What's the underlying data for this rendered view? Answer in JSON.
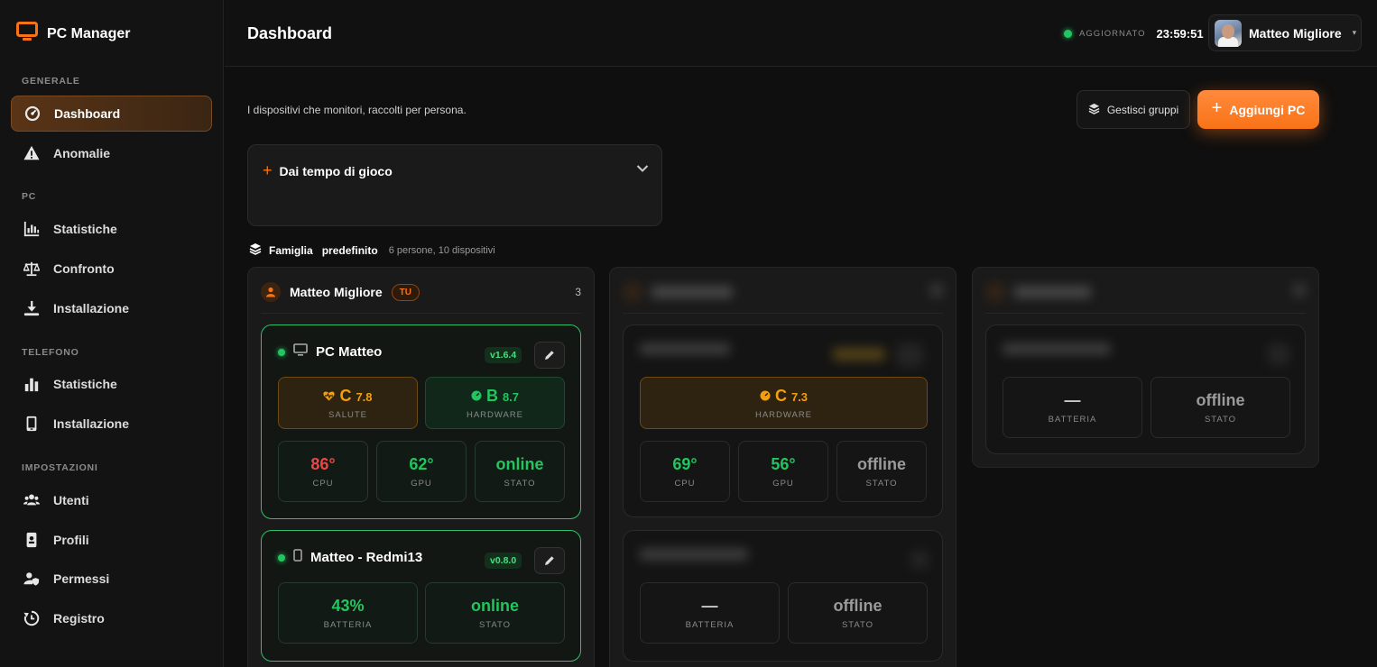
{
  "app": {
    "title": "PC Manager"
  },
  "sidebar": {
    "sections": [
      {
        "label": "GENERALE"
      },
      {
        "label": "PC"
      },
      {
        "label": "TELEFONO"
      },
      {
        "label": "IMPOSTAZIONI"
      }
    ],
    "items": [
      {
        "label": "Dashboard",
        "icon": "dashboard-gauge-icon",
        "active": true
      },
      {
        "label": "Anomalie",
        "icon": "warning-triangle-icon"
      },
      {
        "label": "Statistiche",
        "icon": "bar-chart-icon"
      },
      {
        "label": "Confronto",
        "icon": "scale-icon"
      },
      {
        "label": "Installazione",
        "icon": "download-icon"
      },
      {
        "label": "Statistiche",
        "icon": "bar-chart-icon"
      },
      {
        "label": "Installazione",
        "icon": "phone-icon"
      },
      {
        "label": "Utenti",
        "icon": "users-icon"
      },
      {
        "label": "Profili",
        "icon": "id-card-icon"
      },
      {
        "label": "Permessi",
        "icon": "user-shield-icon"
      },
      {
        "label": "Registro",
        "icon": "history-icon"
      }
    ]
  },
  "header": {
    "title": "Dashboard",
    "status_label": "AGGIORNATO",
    "status_time": "23:59:51",
    "user_name": "Matteo Migliore"
  },
  "toolbar": {
    "subtitle": "I dispositivi che monitori, raccolti per persona.",
    "manage_groups_label": "Gestisci gruppi",
    "add_pc_label": "Aggiungi PC"
  },
  "collapsible": {
    "title": "Dai tempo di gioco"
  },
  "group": {
    "name": "Famiglia",
    "tag": "predefinito",
    "meta": "6 persone, 10 dispositivi"
  },
  "people": [
    {
      "name": "Matteo Migliore",
      "badge": "TU",
      "count": "3",
      "devices": [
        {
          "name": "PC Matteo",
          "version": "v1.6.4",
          "scores": [
            {
              "grade": "C",
              "value": "7.8",
              "label": "SALUTE",
              "icon": "heartbeat-icon"
            },
            {
              "grade": "B",
              "value": "8.7",
              "label": "HARDWARE",
              "icon": "gauge-icon"
            }
          ],
          "metrics": [
            {
              "value": "86°",
              "label": "CPU"
            },
            {
              "value": "62°",
              "label": "GPU"
            },
            {
              "value": "online",
              "label": "STATO"
            }
          ]
        },
        {
          "name": "Matteo - Redmi13",
          "version": "v0.8.0",
          "metrics": [
            {
              "value": "43%",
              "label": "BATTERIA"
            },
            {
              "value": "online",
              "label": "STATO"
            }
          ]
        }
      ]
    },
    {
      "devices": [
        {
          "scores": [
            {
              "grade": "C",
              "value": "7.3",
              "label": "HARDWARE",
              "icon": "gauge-icon"
            }
          ],
          "metrics": [
            {
              "value": "69°",
              "label": "CPU"
            },
            {
              "value": "56°",
              "label": "GPU"
            },
            {
              "value": "offline",
              "label": "STATO"
            }
          ]
        },
        {
          "metrics": [
            {
              "value": "—",
              "label": "BATTERIA"
            },
            {
              "value": "offline",
              "label": "STATO"
            }
          ]
        }
      ]
    },
    {
      "devices": [
        {
          "metrics": [
            {
              "value": "—",
              "label": "BATTERIA"
            },
            {
              "value": "offline",
              "label": "STATO"
            }
          ]
        }
      ]
    }
  ],
  "colors": {
    "accent": "#f97316",
    "online": "#22c55e",
    "warning": "#f59e0b",
    "hot": "#ef4444",
    "offline": "#9a9a9a"
  }
}
